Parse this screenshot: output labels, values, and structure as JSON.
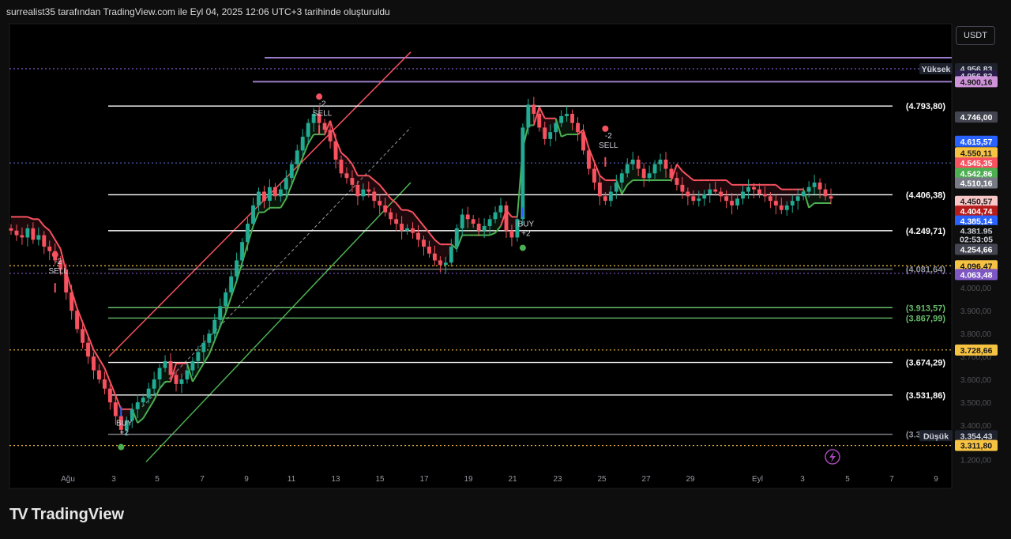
{
  "header": {
    "caption": "surrealist35 tarafından TradingView.com ile Eyl 04, 2025 12:06 UTC+3 tarihinde oluşturuldu"
  },
  "currency_button": "USDT",
  "brand": {
    "logo_icon": "tv-logo-icon",
    "logo_text": "TV",
    "name": "TradingView"
  },
  "colors": {
    "background": "#0e0e0e",
    "up": "#22ab94",
    "down": "#f7525f",
    "trail_up": "#4caf50",
    "trail_down": "#f7525f",
    "level_white": "#ffffff",
    "level_green": "#66bb6a",
    "dotted_orange": "#f5c242",
    "dotted_purple": "#7e57c2"
  },
  "chart_data": {
    "type": "candlestick",
    "ylim": [
      3200,
      5050
    ],
    "x_ticks": [
      "Ağu",
      "3",
      "5",
      "7",
      "9",
      "11",
      "13",
      "15",
      "17",
      "19",
      "21",
      "23",
      "25",
      "27",
      "29",
      "Eyl",
      "3",
      "5",
      "7",
      "9"
    ],
    "y_ticks": [
      "4.000,00",
      "3.900,00",
      "3.800,00",
      "3.700,00",
      "3.600,00",
      "3.500,00",
      "3.400,00",
      "1.200,00"
    ],
    "close_path": [
      4250,
      4230,
      4220,
      4260,
      4210,
      4230,
      4180,
      4160,
      4120,
      4080,
      3980,
      3900,
      3820,
      3760,
      3700,
      3640,
      3600,
      3560,
      3500,
      3440,
      3380,
      3420,
      3470,
      3500,
      3520,
      3560,
      3600,
      3650,
      3680,
      3620,
      3580,
      3600,
      3640,
      3680,
      3720,
      3760,
      3800,
      3860,
      3920,
      3980,
      4050,
      4120,
      4200,
      4280,
      4360,
      4420,
      4380,
      4440,
      4400,
      4430,
      4480,
      4540,
      4600,
      4660,
      4720,
      4760,
      4720,
      4690,
      4640,
      4560,
      4500,
      4480,
      4450,
      4400,
      4430,
      4420,
      4380,
      4360,
      4330,
      4300,
      4280,
      4250,
      4260,
      4240,
      4210,
      4180,
      4150,
      4120,
      4100,
      4110,
      4180,
      4260,
      4320,
      4300,
      4280,
      4250,
      4270,
      4300,
      4330,
      4360,
      4250,
      4220,
      4300,
      4700,
      4800,
      4760,
      4700,
      4650,
      4680,
      4720,
      4750,
      4760,
      4720,
      4680,
      4600,
      4520,
      4460,
      4400,
      4380,
      4420,
      4460,
      4500,
      4540,
      4560,
      4520,
      4480,
      4500,
      4540,
      4560,
      4520,
      4480,
      4450,
      4420,
      4400,
      4380,
      4390,
      4410,
      4430,
      4420,
      4400,
      4380,
      4360,
      4390,
      4420,
      4440,
      4430,
      4410,
      4400,
      4380,
      4360,
      4340,
      4360,
      4380,
      4400,
      4420,
      4440,
      4460,
      4430,
      4400,
      4390
    ],
    "levels": [
      {
        "label": "(4.793,80)",
        "value": 4793.8,
        "kind": "white"
      },
      {
        "label": "(4.406,38)",
        "value": 4406.38,
        "kind": "white"
      },
      {
        "label": "(4.249,71)",
        "value": 4249.71,
        "kind": "white"
      },
      {
        "label": "(4.081,64)",
        "value": 4081.64,
        "kind": "white-faint"
      },
      {
        "label": "(3.913,57)",
        "value": 3913.57,
        "kind": "green"
      },
      {
        "label": "(3.867,99)",
        "value": 3867.99,
        "kind": "green"
      },
      {
        "label": "(3.674,29)",
        "value": 3674.29,
        "kind": "white"
      },
      {
        "label": "(3.531,86)",
        "value": 3531.86,
        "kind": "white"
      },
      {
        "label": "(3.360,49)",
        "value": 3360.49,
        "kind": "grey"
      }
    ],
    "price_tags": [
      {
        "label": "Yüksek",
        "value": 4956.83,
        "bg": "#1e222d",
        "fg": "#d1d4dc",
        "side": "left"
      },
      {
        "label": "4.956,83",
        "value": 4956.83,
        "bg": "#1e222d",
        "fg": "#d1d4dc"
      },
      {
        "label": "4.956,83",
        "value": 4925,
        "bg": "#2a1d4a",
        "fg": "#d1d4dc"
      },
      {
        "label": "4.900,16",
        "value": 4900.16,
        "bg": "#ce93d8",
        "fg": "#1b1b1b"
      },
      {
        "label": "4.746,00",
        "value": 4746.0,
        "bg": "#434651",
        "fg": "#ffffff"
      },
      {
        "label": "4.615,57",
        "value": 4640,
        "bg": "#2962ff",
        "fg": "#ffffff"
      },
      {
        "label": "4.550,11",
        "value": 4590,
        "bg": "#f5c242",
        "fg": "#1b1b1b"
      },
      {
        "label": "4.545,35",
        "value": 4545.35,
        "bg": "#f7525f",
        "fg": "#ffffff"
      },
      {
        "label": "4.542,86",
        "value": 4500,
        "bg": "#4caf50",
        "fg": "#ffffff"
      },
      {
        "label": "4.510,16",
        "value": 4458,
        "bg": "#787b86",
        "fg": "#ffffff"
      },
      {
        "label": "4.450,57",
        "value": 4378,
        "bg": "#f8c8c8",
        "fg": "#1b1b1b"
      },
      {
        "label": "4.404,74",
        "value": 4335,
        "bg": "#b71c1c",
        "fg": "#ffffff"
      },
      {
        "label": "4.385,14",
        "value": 4292,
        "bg": "#2962ff",
        "fg": "#ffffff"
      },
      {
        "label": "4.381,95",
        "value": 4250,
        "bg": "#0e0e0e",
        "fg": "#d1d4dc"
      },
      {
        "label": "02:53:05",
        "value": 4213,
        "bg": "#0e0e0e",
        "fg": "#d1d4dc"
      },
      {
        "label": "4.254,66",
        "value": 4168,
        "bg": "#434651",
        "fg": "#ffffff"
      },
      {
        "label": "4.096,47",
        "value": 4096.47,
        "bg": "#f5c242",
        "fg": "#1b1b1b"
      },
      {
        "label": "4.063,48",
        "value": 4058,
        "bg": "#7e57c2",
        "fg": "#ffffff"
      },
      {
        "label": "3.728,66",
        "value": 3728.66,
        "bg": "#f5c242",
        "fg": "#1b1b1b"
      },
      {
        "label": "Düşük",
        "value": 3354.43,
        "bg": "#1e222d",
        "fg": "#d1d4dc",
        "side": "left"
      },
      {
        "label": "3.354,43",
        "value": 3354.43,
        "bg": "#1e222d",
        "fg": "#d1d4dc"
      },
      {
        "label": "3.311,80",
        "value": 3311.8,
        "bg": "#f5c242",
        "fg": "#1b1b1b"
      }
    ],
    "dotted_lines": [
      {
        "value": 4956.83,
        "color": "#7e57c2"
      },
      {
        "value": 4545.35,
        "color": "#5c6bc0"
      },
      {
        "value": 4096.47,
        "color": "#f5c242"
      },
      {
        "value": 4063.48,
        "color": "#7e57c2"
      },
      {
        "value": 3728.66,
        "color": "#f5c242"
      },
      {
        "value": 3311.8,
        "color": "#f5c242"
      }
    ],
    "signals": [
      {
        "label": "SELL",
        "count": "-2",
        "bar": 8,
        "price": 4000,
        "dir": "down"
      },
      {
        "label": "BUY",
        "count": "+2",
        "bar": 20,
        "price": 3460,
        "dir": "up"
      },
      {
        "label": "SELL",
        "count": "-2",
        "bar": 56,
        "price": 4690,
        "dir": "down"
      },
      {
        "label": "BUY",
        "count": "+2",
        "bar": 93,
        "price": 4330,
        "dir": "up"
      },
      {
        "label": "SELL",
        "count": "-2",
        "bar": 108,
        "price": 4550,
        "dir": "down"
      }
    ]
  }
}
